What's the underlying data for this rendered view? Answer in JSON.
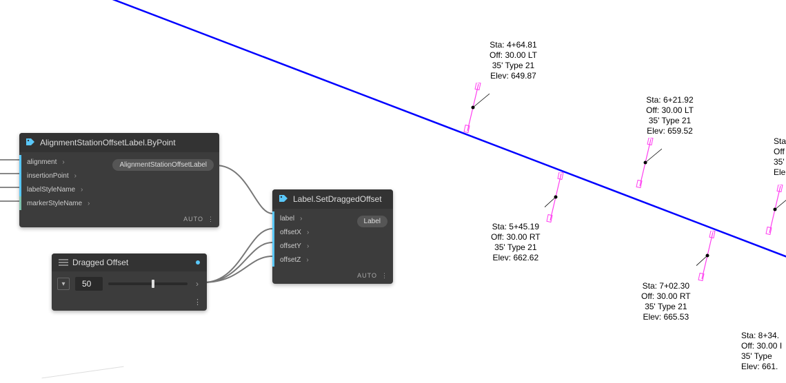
{
  "nodes": {
    "byPoint": {
      "title": "AlignmentStationOffsetLabel.ByPoint",
      "inputs": [
        "alignment",
        "insertionPoint",
        "labelStyleName",
        "markerStyleName"
      ],
      "output": "AlignmentStationOffsetLabel",
      "footer": "AUTO"
    },
    "setDragged": {
      "title": "Label.SetDraggedOffset",
      "inputs": [
        "label",
        "offsetX",
        "offsetY",
        "offsetZ"
      ],
      "output": "Label",
      "footer": "AUTO"
    },
    "slider": {
      "title": "Dragged Offset",
      "value": "50"
    }
  },
  "labels": [
    {
      "sta": "Sta: 4+64.81",
      "off": "Off: 30.00 LT",
      "type": "35' Type 21",
      "elev": "Elev: 649.87"
    },
    {
      "sta": "Sta: 6+21.92",
      "off": "Off: 30.00 LT",
      "type": "35' Type 21",
      "elev": "Elev: 659.52"
    },
    {
      "sta": "Sta:",
      "off": "Off",
      "type": "35'",
      "elev": "Ele"
    },
    {
      "sta": "Sta: 5+45.19",
      "off": "Off: 30.00 RT",
      "type": "35' Type 21",
      "elev": "Elev: 662.62"
    },
    {
      "sta": "Sta: 7+02.30",
      "off": "Off: 30.00 RT",
      "type": "35' Type 21",
      "elev": "Elev: 665.53"
    },
    {
      "sta": "Sta: 8+34.",
      "off": "Off: 30.00 I",
      "type": "35' Type",
      "elev": "Elev: 661."
    }
  ],
  "icons": {
    "tag": "tag-icon",
    "chevron": "›"
  }
}
